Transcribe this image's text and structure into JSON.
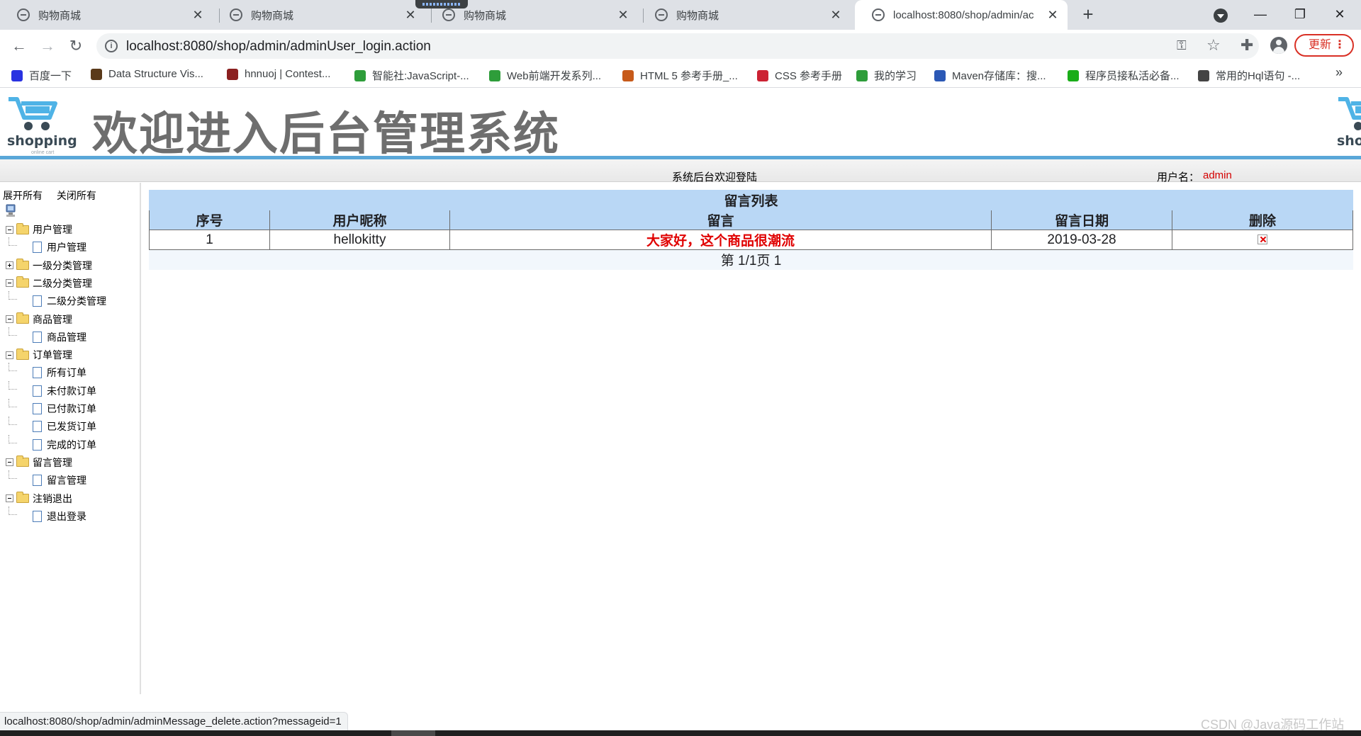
{
  "browser": {
    "tabs": [
      {
        "title": "购物商城",
        "active": false
      },
      {
        "title": "购物商城",
        "active": false
      },
      {
        "title": "购物商城",
        "active": false
      },
      {
        "title": "购物商城",
        "active": false
      },
      {
        "title": "localhost:8080/shop/admin/ac",
        "active": true
      }
    ],
    "new_tab_label": "+",
    "window_controls": {
      "minimize": "—",
      "restore": "❐",
      "close": "✕"
    },
    "url": "localhost:8080/shop/admin/adminUser_login.action",
    "update_button": "更新",
    "bookmarks": [
      {
        "label": "百度一下",
        "icon": "baidu-icon",
        "color": "#2932e1"
      },
      {
        "label": "Data Structure Vis...",
        "icon": "dsv-icon",
        "color": "#5a3a1a"
      },
      {
        "label": "hnnuoj | Contest...",
        "icon": "hnnuoj-icon",
        "color": "#8b2020"
      },
      {
        "label": "智能社:JavaScript-...",
        "icon": "folder-icon",
        "color": "#2e9d3a"
      },
      {
        "label": "Web前端开发系列...",
        "icon": "folder-icon",
        "color": "#2e9d3a"
      },
      {
        "label": "HTML 5 参考手册_...",
        "icon": "w3-icon",
        "color": "#c75a1a"
      },
      {
        "label": "CSS 参考手册",
        "icon": "css-icon",
        "color": "#cc2233"
      },
      {
        "label": "我的学习",
        "icon": "folder-icon",
        "color": "#2e9d3a"
      },
      {
        "label": "Maven存储库：搜...",
        "icon": "mvn-icon",
        "color": "#2b58b5"
      },
      {
        "label": "程序员接私活必备...",
        "icon": "wechat-icon",
        "color": "#1aad19"
      },
      {
        "label": "常用的Hql语句 -...",
        "icon": "blog-icon",
        "color": "#444444"
      }
    ],
    "bookmarks_more": "»",
    "status_url": "localhost:8080/shop/admin/adminMessage_delete.action?messageid=1"
  },
  "page": {
    "logo_text": "shopping",
    "logo_sub": "online cart",
    "logo_right_text": "sho",
    "banner_title": "欢迎进入后台管理系统",
    "welcome_text": "系统后台欢迎登陆",
    "user_label": "用户名：",
    "user_name": "admin",
    "accent_color": "#5aa7d8",
    "highlight_color": "#e00000"
  },
  "sidebar": {
    "expand_all": "展开所有",
    "collapse_all": "关闭所有",
    "tree": [
      {
        "label": "用户管理",
        "level": 0,
        "toggle": "minus"
      },
      {
        "label": "用户管理",
        "level": 1
      },
      {
        "label": "一级分类管理",
        "level": 0,
        "toggle": "plus"
      },
      {
        "label": "二级分类管理",
        "level": 0,
        "toggle": "minus"
      },
      {
        "label": "二级分类管理",
        "level": 1
      },
      {
        "label": "商品管理",
        "level": 0,
        "toggle": "minus"
      },
      {
        "label": "商品管理",
        "level": 1
      },
      {
        "label": "订单管理",
        "level": 0,
        "toggle": "minus"
      },
      {
        "label": "所有订单",
        "level": 1
      },
      {
        "label": "未付款订单",
        "level": 1
      },
      {
        "label": "已付款订单",
        "level": 1
      },
      {
        "label": "已发货订单",
        "level": 1
      },
      {
        "label": "完成的订单",
        "level": 1
      },
      {
        "label": "留言管理",
        "level": 0,
        "toggle": "minus"
      },
      {
        "label": "留言管理",
        "level": 1
      },
      {
        "label": "注销退出",
        "level": 0,
        "toggle": "minus"
      },
      {
        "label": "退出登录",
        "level": 1
      }
    ]
  },
  "message_table": {
    "caption": "留言列表",
    "headers": [
      "序号",
      "用户昵称",
      "留言",
      "留言日期",
      "删除"
    ],
    "rows": [
      {
        "id": "1",
        "nickname": "hellokitty",
        "message": "大家好，这个商品很潮流",
        "date": "2019-03-28",
        "delete_icon": "delete-icon"
      }
    ],
    "pager": "第 1/1页 1"
  },
  "watermark": "CSDN @Java源码工作站"
}
